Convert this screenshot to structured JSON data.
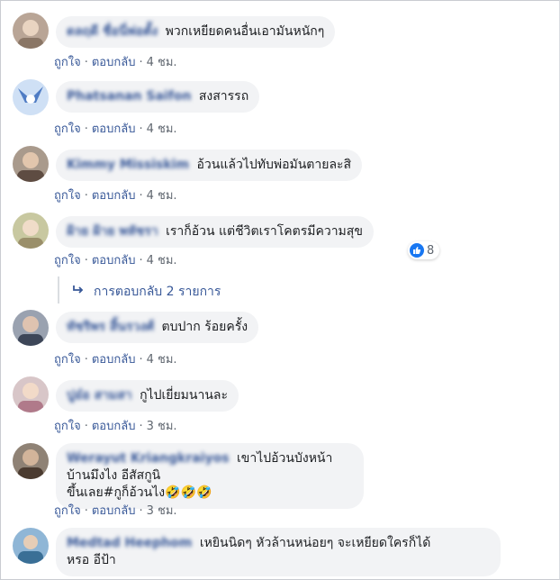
{
  "comments": [
    {
      "name": "ดลฤดี ชื่อนี่พ่อตั้ง",
      "text": "พวกเหยียดคนอื่นเอามันหนักๆ",
      "like": "ถูกใจ",
      "reply": "ตอบกลับ",
      "time": "4 ชม."
    },
    {
      "name": "Phatsanan Saifon",
      "text": "สงสารรถ",
      "like": "ถูกใจ",
      "reply": "ตอบกลับ",
      "time": "4 ชม."
    },
    {
      "name": "Kimmy Missiskim",
      "text": "อ้วนแล้วไปทับพ่อมันตายละสิ",
      "like": "ถูกใจ",
      "reply": "ตอบกลับ",
      "time": "4 ชม."
    },
    {
      "name": "ฝ้าย ฝ้าย พหัชรา",
      "text": "เราก็อ้วน แต่ชีวิตเราโคตรมีความสุข",
      "like": "ถูกใจ",
      "reply": "ตอบกลับ",
      "time": "4 ชม.",
      "reaction_count": "8"
    },
    {
      "name": "ทัชริพร สิ้นรวงศ์",
      "text": "ตบปาก ร้อยครั้ง",
      "like": "ถูกใจ",
      "reply": "ตอบกลับ",
      "time": "4 ชม."
    },
    {
      "name": "ปูอ๋อ สามสา",
      "text": "กูไปเยี่ยมนานละ",
      "like": "ถูกใจ",
      "reply": "ตอบกลับ",
      "time": "3 ชม."
    },
    {
      "name": "Werayut Kriangkraiyos",
      "text": "เขาไปอ้วนบังหน้าบ้านมึงไง อีสัสกูนิ",
      "text2": "ขึ้นเลย#กูก็อ้วนไง",
      "emoji": "🤣🤣🤣",
      "like": "ถูกใจ",
      "reply": "ตอบกลับ",
      "time": "3 ชม."
    },
    {
      "name": "Medtad Heephom",
      "text": "เหยินนิดๆ หัวล้านหน่อยๆ จะเหยียดใครก็ได้",
      "text2": "หรอ อีป้า"
    }
  ],
  "replies_link": "การตอบกลับ 2 รายการ",
  "dot_separator": "·",
  "colors": {
    "link": "#385898",
    "bubble": "#f2f3f5",
    "like": "#1877f2",
    "meta": "#606770"
  }
}
